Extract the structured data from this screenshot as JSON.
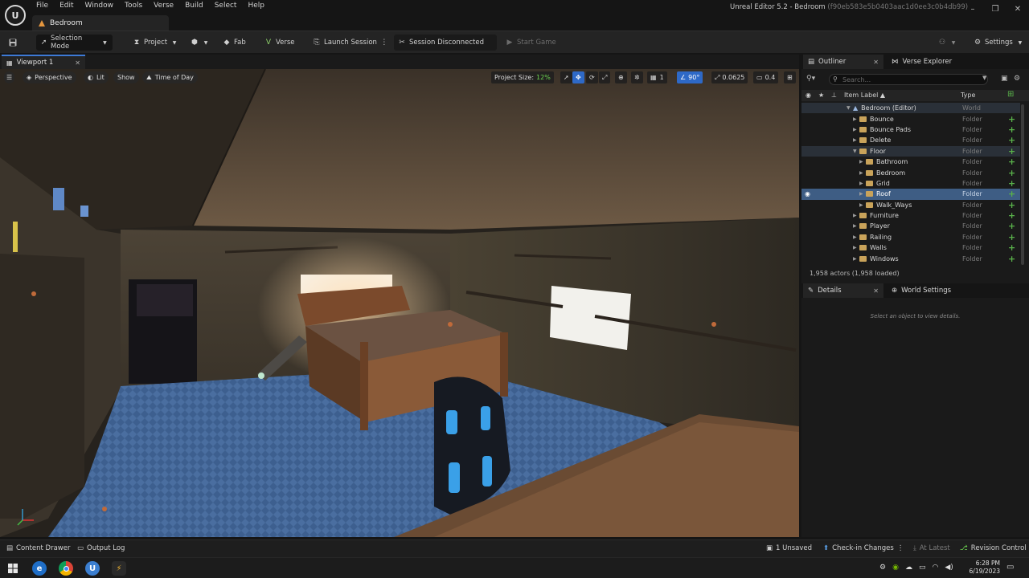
{
  "app": {
    "window_title": "Unreal Editor 5.2 - Bedroom",
    "window_hash": "(f90eb583e5b0403aac1d0ee3c0b4db99)",
    "document_tab": "Bedroom"
  },
  "menu": [
    "File",
    "Edit",
    "Window",
    "Tools",
    "Verse",
    "Build",
    "Select",
    "Help"
  ],
  "toolbar": {
    "selection_mode": "Selection Mode",
    "project": "Project",
    "fab": "Fab",
    "verse": "Verse",
    "launch_session": "Launch Session",
    "session_status": "Session Disconnected",
    "start_game": "Start Game",
    "settings": "Settings"
  },
  "viewport": {
    "tab_label": "Viewport 1",
    "perspective": "Perspective",
    "lit": "Lit",
    "show": "Show",
    "time_of_day": "Time of Day",
    "project_size_label": "Project Size:",
    "project_size_value": "12%",
    "grid_value": "1",
    "angle_value": "90°",
    "scale_value": "0.0625",
    "camera_speed": "0.4"
  },
  "outliner": {
    "tab_label": "Outliner",
    "verse_explorer_label": "Verse Explorer",
    "search_placeholder": "Search...",
    "col_item_label": "Item Label ▲",
    "col_type": "Type",
    "rows": [
      {
        "label": "Bedroom (Editor)",
        "type": "World"
      },
      {
        "label": "Bounce",
        "type": "Folder"
      },
      {
        "label": "Bounce Pads",
        "type": "Folder"
      },
      {
        "label": "Delete",
        "type": "Folder"
      },
      {
        "label": "Floor",
        "type": "Folder"
      },
      {
        "label": "Bathroom",
        "type": "Folder"
      },
      {
        "label": "Bedroom",
        "type": "Folder"
      },
      {
        "label": "Grid",
        "type": "Folder"
      },
      {
        "label": "Roof",
        "type": "Folder"
      },
      {
        "label": "Walk_Ways",
        "type": "Folder"
      },
      {
        "label": "Furniture",
        "type": "Folder"
      },
      {
        "label": "Player",
        "type": "Folder"
      },
      {
        "label": "Railing",
        "type": "Folder"
      },
      {
        "label": "Walls",
        "type": "Folder"
      },
      {
        "label": "Windows",
        "type": "Folder"
      }
    ],
    "actor_count": "1,958 actors (1,958 loaded)"
  },
  "details": {
    "tab_label": "Details",
    "world_settings_label": "World Settings",
    "empty_message": "Select an object to view details."
  },
  "statusbar": {
    "content_drawer": "Content Drawer",
    "output_log": "Output Log",
    "unsaved": "1 Unsaved",
    "check_in": "Check-in Changes",
    "at_latest": "At Latest",
    "revision_control": "Revision Control"
  },
  "taskbar": {
    "time": "6:28 PM",
    "date": "6/19/2023"
  },
  "colors": {
    "accent": "#3d7ad6",
    "selected_row": "#3e5d84",
    "add_green": "#59b04a",
    "folder": "#c9a35a"
  }
}
